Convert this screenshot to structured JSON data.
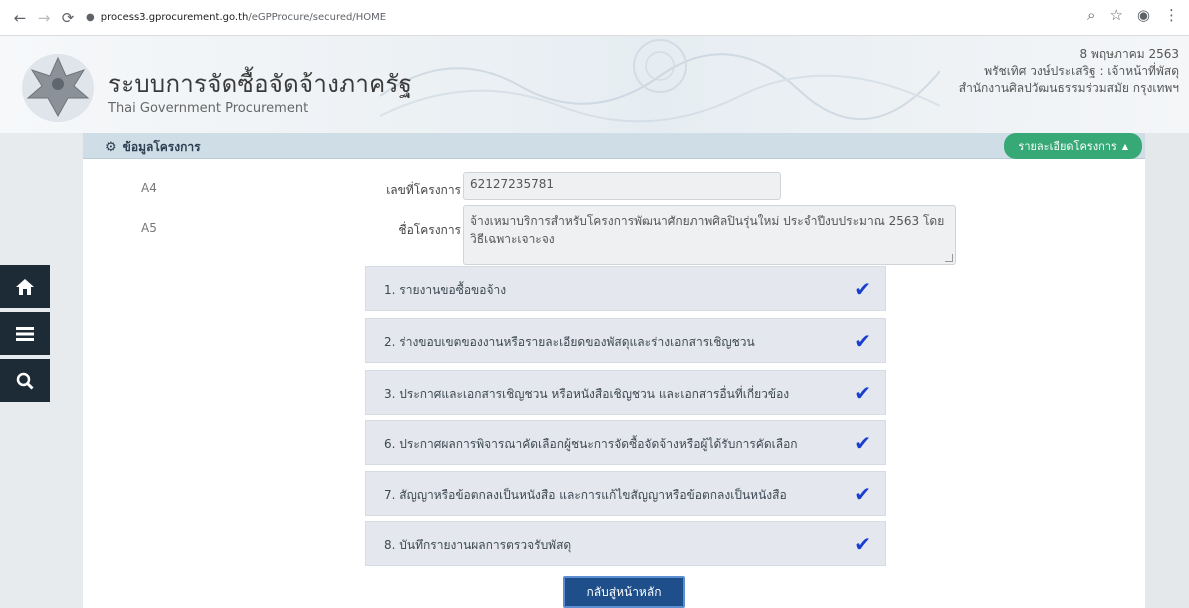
{
  "browser": {
    "url_host": "process3.gprocurement.go.th",
    "url_path": "/eGPProcure/secured/HOME"
  },
  "header": {
    "title_th": "ระบบการจัดซื้อจัดจ้างภาครัฐ",
    "title_en": "Thai Government Procurement",
    "user_date": "8 พฤษภาคม 2563",
    "user_name": "พรัชเทิศ วงษ์ประเสริฐ : เจ้าหน้าที่พัสดุ",
    "user_org": "สำนักงานศิลปวัฒนธรรมร่วมสมัย กรุงเทพฯ"
  },
  "panel": {
    "title": "ข้อมูลโครงการ",
    "detail_button": "รายละเอียดโครงการ"
  },
  "fields": {
    "a4_code": "A4",
    "a4_label": "เลขที่โครงการ",
    "a4_value": "62127235781",
    "a5_code": "A5",
    "a5_label": "ชื่อโครงการ",
    "a5_value": "จ้างเหมาบริการสำหรับโครงการพัฒนาศักยภาพศิลปินรุ่นใหม่ ประจำปีงบประมาณ 2563 โดยวิธีเฉพาะเจาะจง"
  },
  "steps": [
    {
      "label": "1. รายงานขอซื้อขอจ้าง"
    },
    {
      "label": "2. ร่างขอบเขตของงานหรือรายละเอียดของพัสดุและร่างเอกสารเชิญชวน"
    },
    {
      "label": "3. ประกาศและเอกสารเชิญชวน หรือหนังสือเชิญชวน และเอกสารอื่นที่เกี่ยวข้อง"
    },
    {
      "label": "6. ประกาศผลการพิจารณาคัดเลือกผู้ชนะการจัดซื้อจัดจ้างหรือผู้ได้รับการคัดเลือก"
    },
    {
      "label": "7. สัญญาหรือข้อตกลงเป็นหนังสือ และการแก้ไขสัญญาหรือข้อตกลงเป็นหนังสือ"
    },
    {
      "label": "8. บันทึกรายงานผลการตรวจรับพัสดุ"
    }
  ],
  "actions": {
    "home_button": "กลับสู่หน้าหลัก"
  },
  "colors": {
    "panel_header": "#cfdde7",
    "accent_green": "#37a977",
    "check_blue": "#1a3fd0",
    "side_menu": "#1c2b36",
    "home_button": "#1e4f8a"
  }
}
